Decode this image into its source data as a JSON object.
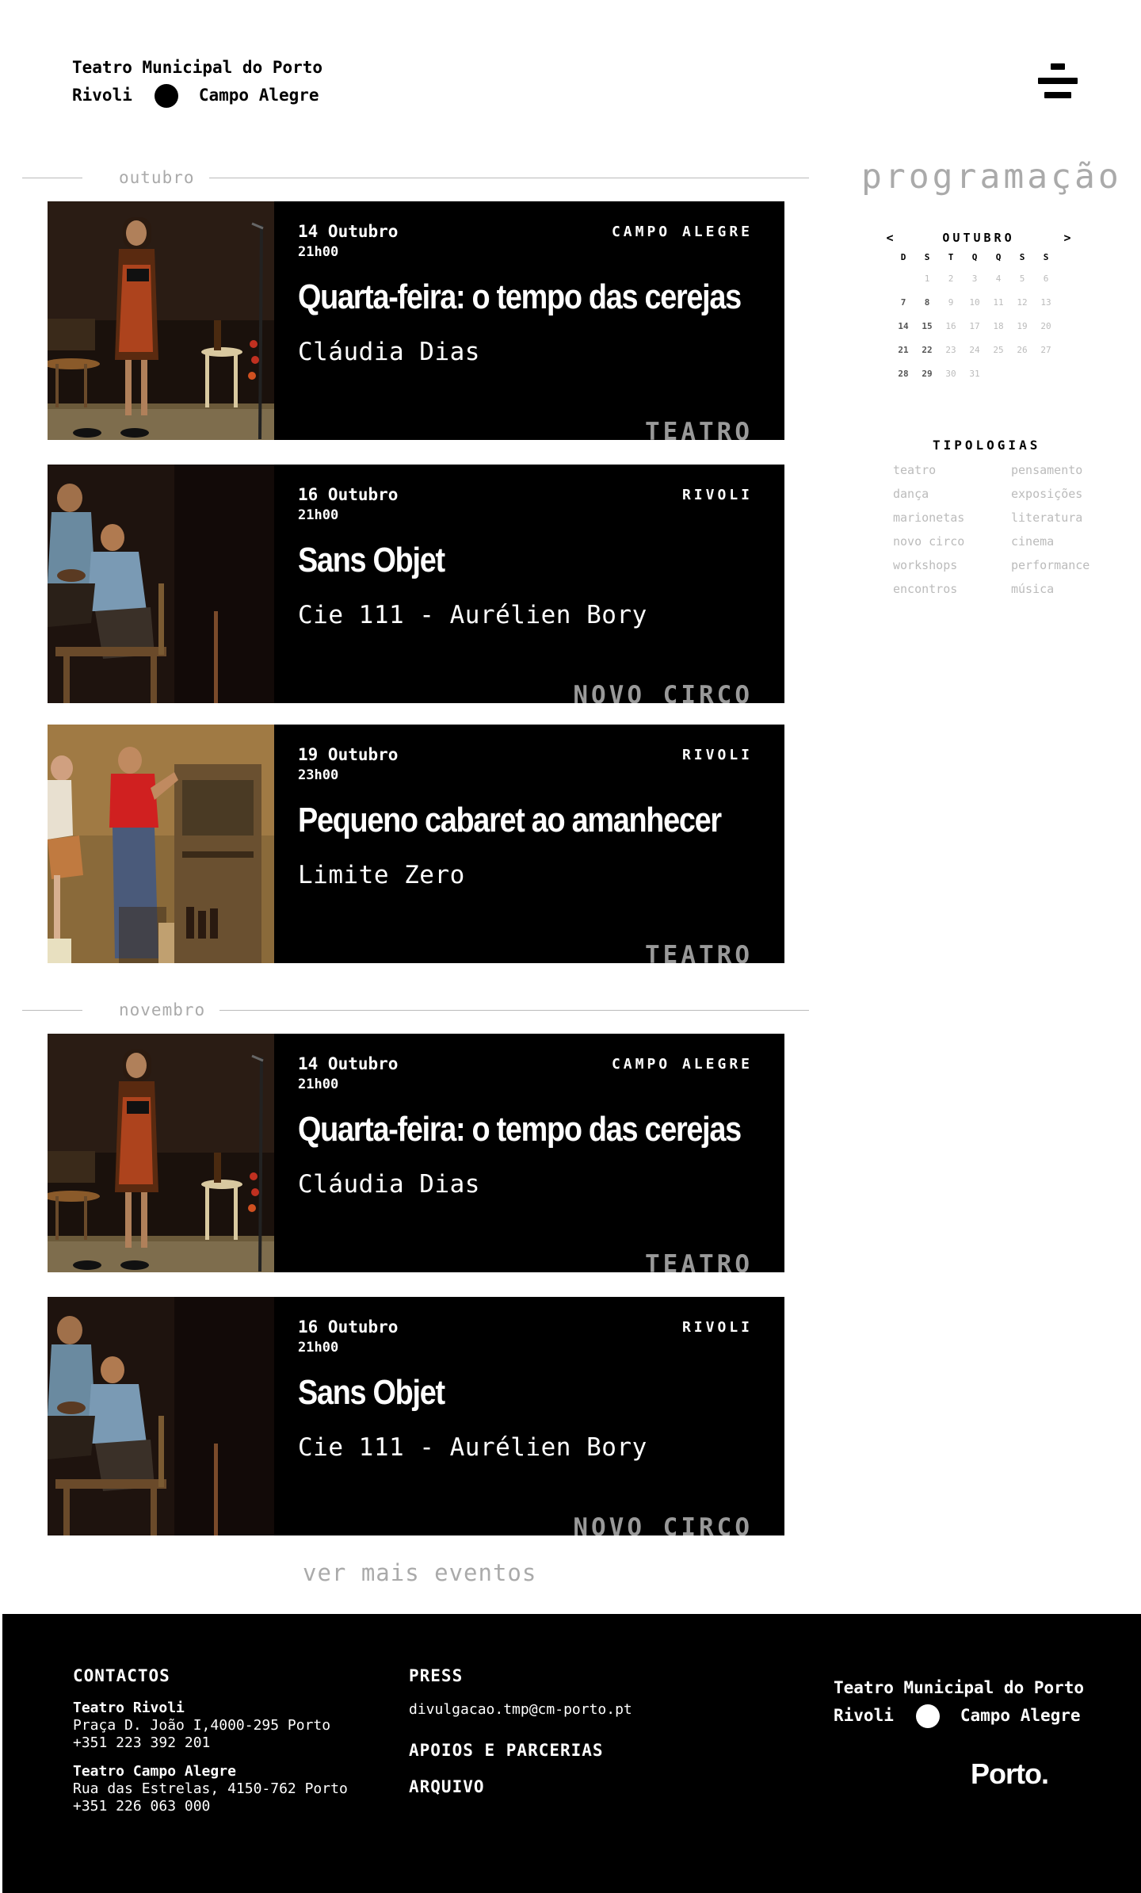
{
  "header": {
    "brand_line1": "Teatro Municipal do Porto",
    "brand_left": "Rivoli",
    "brand_right": "Campo Alegre",
    "menu_icon": "menu-icon"
  },
  "months": [
    {
      "label": "outubro"
    },
    {
      "label": "novembro"
    }
  ],
  "events": [
    {
      "date": "14 Outubro",
      "time": "21h00",
      "venue": "CAMPO ALEGRE",
      "title": "Quarta-feira: o tempo das cerejas",
      "artist": "Cláudia Dias",
      "type": "TEATRO"
    },
    {
      "date": "16 Outubro",
      "time": "21h00",
      "venue": "RIVOLI",
      "title": "Sans Objet",
      "artist": "Cie 111 - Aurélien Bory",
      "type": "NOVO CIRCO"
    },
    {
      "date": "19 Outubro",
      "time": "23h00",
      "venue": "RIVOLI",
      "title": "Pequeno cabaret ao amanhecer",
      "artist": "Limite Zero",
      "type": "TEATRO"
    },
    {
      "date": "14 Outubro",
      "time": "21h00",
      "venue": "CAMPO ALEGRE",
      "title": "Quarta-feira: o tempo das cerejas",
      "artist": "Cláudia Dias",
      "type": "TEATRO"
    },
    {
      "date": "16 Outubro",
      "time": "21h00",
      "venue": "RIVOLI",
      "title": "Sans Objet",
      "artist": "Cie 111 - Aurélien Bory",
      "type": "NOVO CIRCO"
    }
  ],
  "ver_mais": "ver mais eventos",
  "sidebar": {
    "title": "programação",
    "calendar": {
      "prev": "<",
      "next": ">",
      "month": "OUTUBRO",
      "weekdays": [
        "D",
        "S",
        "T",
        "Q",
        "Q",
        "S",
        "S"
      ],
      "days": [
        "1",
        "2",
        "3",
        "4",
        "5",
        "6",
        "7",
        "8",
        "9",
        "10",
        "11",
        "12",
        "13",
        "14",
        "15",
        "16",
        "17",
        "18",
        "19",
        "20",
        "21",
        "22",
        "23",
        "24",
        "25",
        "26",
        "27",
        "28",
        "29",
        "30",
        "31"
      ],
      "bold_days": [
        "7",
        "8",
        "14",
        "15",
        "21",
        "22",
        "28",
        "29"
      ]
    },
    "tipologias_title": "TIPOLOGIAS",
    "tipologias": [
      "teatro",
      "pensamento",
      "dança",
      "exposições",
      "marionetas",
      "literatura",
      "novo circo",
      "cinema",
      "workshops",
      "performance",
      "encontros",
      "música"
    ]
  },
  "footer": {
    "contactos": "CONTACTOS",
    "rivoli_name": "Teatro Rivoli",
    "rivoli_address": "Praça D. João I,4000-295 Porto",
    "rivoli_phone": "+351 223 392 201",
    "campo_name": "Teatro Campo Alegre",
    "campo_address": "Rua das Estrelas, 4150-762 Porto",
    "campo_phone": "+351 226 063 000",
    "press": "PRESS",
    "press_email": "divulgacao.tmp@cm-porto.pt",
    "apoios": "APOIOS E PARCERIAS",
    "arquivo": "ARQUIVO",
    "brand_line1": "Teatro Municipal do Porto",
    "brand_left": "Rivoli",
    "brand_right": "Campo Alegre",
    "porto_logo": "Porto."
  },
  "colors": {
    "background": "#ffffff",
    "card": "#000000",
    "muted": "#aaaaaa",
    "type_label": "#999999"
  }
}
